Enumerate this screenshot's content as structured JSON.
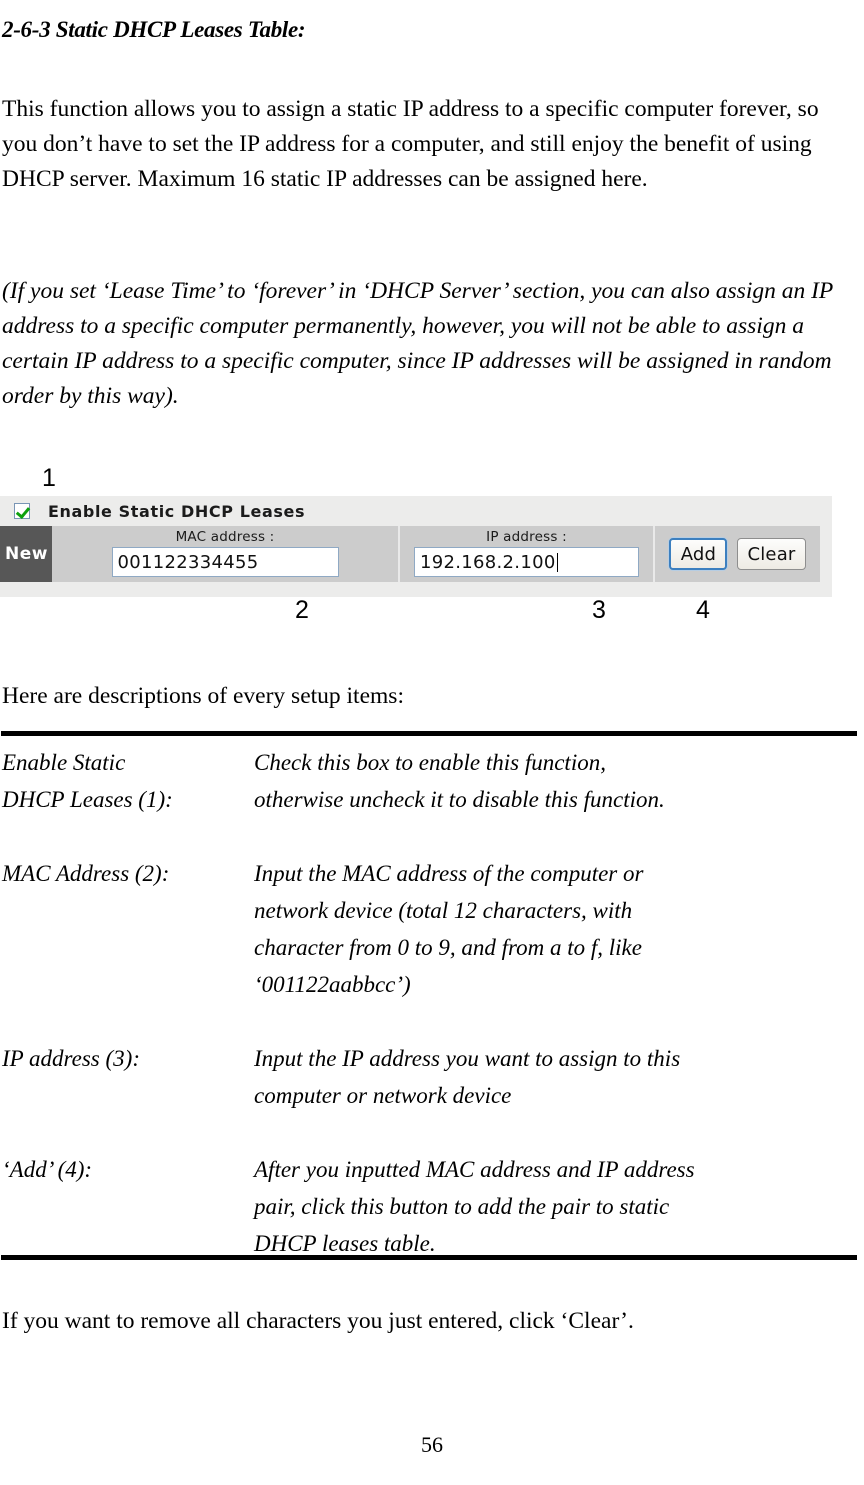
{
  "document": {
    "heading": "2-6-3 Static DHCP Leases Table:",
    "intro_paragraph": "This function allows you to assign a static IP address to a specific computer forever, so you don’t have to set the IP address for a computer, and still enjoy the benefit of using DHCP server. Maximum 16 static IP addresses can be assigned here.",
    "note_paragraph": "(If you set ‘Lease Time’ to ‘forever’ in ‘DHCP Server’ section, you can also assign an IP address to a specific computer permanently, however, you will not be able to assign a certain IP address to a specific computer, since IP addresses will be assigned in random order by this way).",
    "descriptions_lead": "Here are descriptions of every setup items:",
    "closing_paragraph": "If you want to remove all characters you just entered, click ‘Clear’.",
    "page_number": "56"
  },
  "callouts": {
    "one": "1",
    "two": "2",
    "three": "3",
    "four": "4"
  },
  "screenshot": {
    "enable_checkbox_label": "Enable Static DHCP Leases",
    "enable_checkbox_checked": true,
    "row_label": "New",
    "mac_field": {
      "label": "MAC address :",
      "value": "001122334455"
    },
    "ip_field": {
      "label": "IP address :",
      "value": "192.168.2.100"
    },
    "buttons": {
      "add": "Add",
      "clear": "Clear"
    },
    "colors": {
      "panel_bg": "#ececeb",
      "row_bg": "#cccccc",
      "new_cell_bg": "#575757",
      "check_green": "#0ea10e",
      "focus_blue": "#3c7fbf",
      "input_border": "#8fa9c4"
    }
  },
  "definitions": [
    {
      "term": "Enable Static\nDHCP Leases (1):",
      "description": "Check this box to enable this function,\notherwise uncheck it to disable this function."
    },
    {
      "term": "MAC Address (2):",
      "description": "Input the MAC address of the computer or\nnetwork device (total 12 characters, with\ncharacter from 0 to 9, and from a to f, like\n‘001122aabbcc’)"
    },
    {
      "term": "IP address (3):",
      "description": "Input the IP address you want to assign to this\ncomputer or network device"
    },
    {
      "term": "‘Add’ (4):",
      "description": "After you inputted MAC address and IP address\npair, click this button to add the pair to static\nDHCP leases table."
    }
  ]
}
